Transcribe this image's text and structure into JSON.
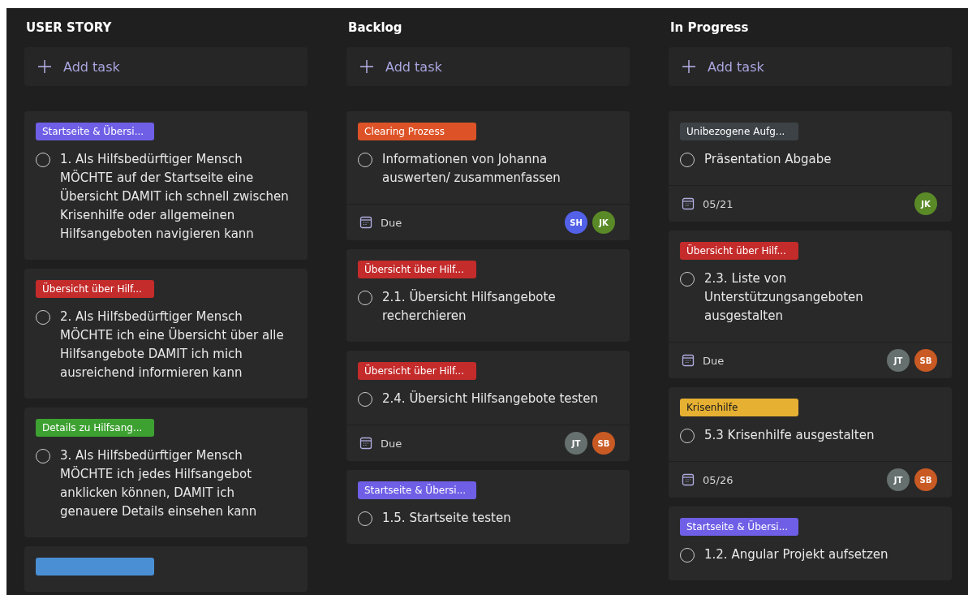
{
  "columns": [
    {
      "title": "USER STORY",
      "add_label": "Add task",
      "cards": [
        {
          "tag": {
            "label": "Startseite & Übersi...",
            "color": "#6f5fe6"
          },
          "title": "1. Als Hilfsbedürftiger Mensch MÖCHTE auf der Startseite eine Übersicht DAMIT ich schnell zwischen Krisenhilfe oder allgemeinen Hilfsangeboten navigieren kann",
          "done": false
        },
        {
          "tag": {
            "label": "Übersicht über Hilf...",
            "color": "#c42b2b"
          },
          "title": "2. Als Hilfsbedürftiger Mensch MÖCHTE ich eine Übersicht über alle Hilfsangebote DAMIT ich mich ausreichend informieren kann",
          "done": false
        },
        {
          "tag": {
            "label": "Details zu Hilfsang...",
            "color": "#3da131"
          },
          "title": "3. Als Hilfsbedürftiger Mensch MÖCHTE ich jedes Hilfsangebot anklicken können, DAMIT ich genauere Details einsehen kann",
          "done": false
        },
        {
          "tag": {
            "color": "#4a8fd4"
          }
        }
      ]
    },
    {
      "title": "Backlog",
      "add_label": "Add task",
      "cards": [
        {
          "tag": {
            "label": "Clearing Prozess",
            "color": "#dd5327"
          },
          "title": "Informationen von Johanna auswerten/ zusammenfassen",
          "done": false,
          "due": "Due",
          "assignees": [
            {
              "initials": "SH",
              "color": "#5261e8"
            },
            {
              "initials": "JK",
              "color": "#5a8a27"
            }
          ]
        },
        {
          "tag": {
            "label": "Übersicht über Hilf...",
            "color": "#c42b2b"
          },
          "title": "2.1. Übersicht Hilfsangebote recherchieren",
          "done": false
        },
        {
          "tag": {
            "label": "Übersicht über Hilf...",
            "color": "#c42b2b"
          },
          "title": "2.4. Übersicht Hilfsangebote testen",
          "done": false,
          "due": "Due",
          "assignees": [
            {
              "initials": "JT",
              "color": "#66716f"
            },
            {
              "initials": "SB",
              "color": "#c95a24"
            }
          ]
        },
        {
          "tag": {
            "label": "Startseite & Übersi...",
            "color": "#6f5fe6"
          },
          "title": "1.5. Startseite testen",
          "done": false
        }
      ]
    },
    {
      "title": "In Progress",
      "add_label": "Add task",
      "cards": [
        {
          "tag": {
            "label": "Unibezogene Aufg...",
            "color": "#3c4246"
          },
          "title": "Präsentation Abgabe",
          "done": false,
          "due": "05/21",
          "assignees": [
            {
              "initials": "JK",
              "color": "#5a8a27"
            }
          ]
        },
        {
          "tag": {
            "label": "Übersicht über Hilf...",
            "color": "#c42b2b"
          },
          "title": "2.3. Liste von Unterstützungsangeboten ausgestalten",
          "done": false,
          "due": "Due",
          "assignees": [
            {
              "initials": "JT",
              "color": "#66716f"
            },
            {
              "initials": "SB",
              "color": "#c95a24"
            }
          ]
        },
        {
          "tag": {
            "label": "Krisenhilfe",
            "color": "#e6b032"
          },
          "title": "5.3 Krisenhilfe ausgestalten",
          "done": false,
          "due": "05/26",
          "assignees": [
            {
              "initials": "JT",
              "color": "#66716f"
            },
            {
              "initials": "SB",
              "color": "#c95a24"
            }
          ]
        },
        {
          "tag": {
            "label": "Startseite & Übersi...",
            "color": "#6f5fe6"
          },
          "title": "1.2. Angular Projekt aufsetzen",
          "done": false
        }
      ]
    }
  ]
}
